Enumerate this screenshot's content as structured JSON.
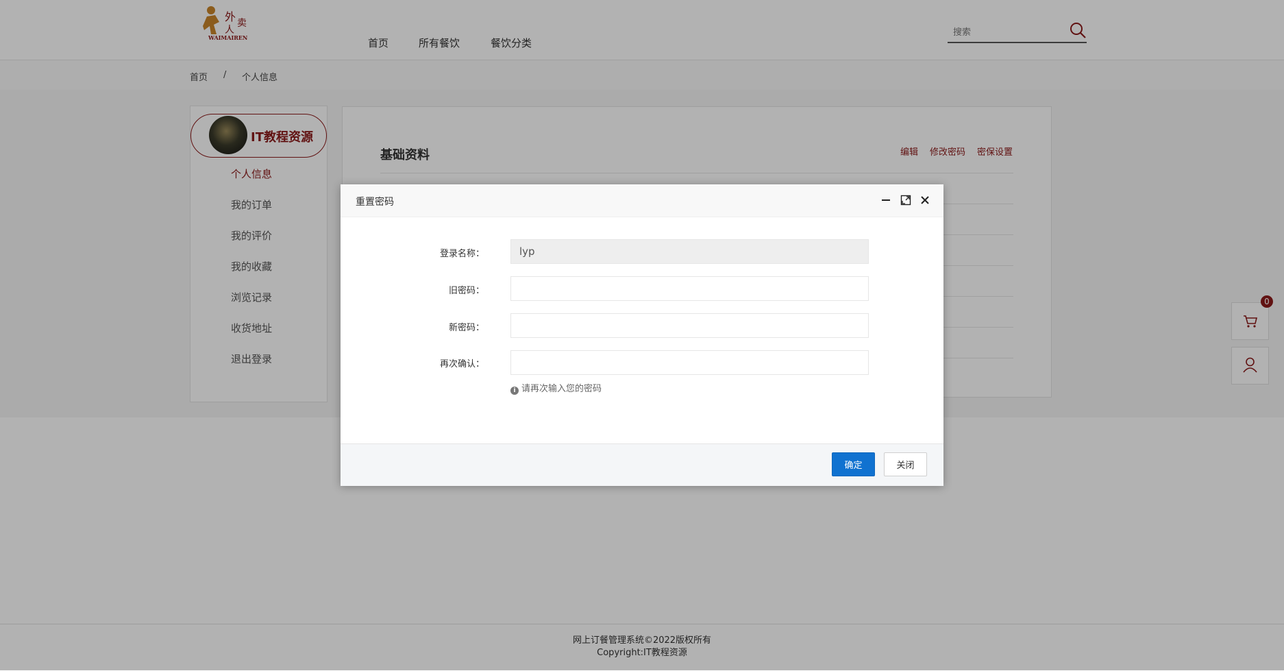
{
  "header": {
    "logo_alt": "WAIMAIREN",
    "nav": [
      "首页",
      "所有餐饮",
      "餐饮分类"
    ],
    "search_placeholder": "搜索"
  },
  "breadcrumb": {
    "home": "首页",
    "sep": "/",
    "current": "个人信息"
  },
  "sidebar": {
    "user_name": "IT教程资源",
    "items": [
      {
        "label": "个人信息",
        "active": true
      },
      {
        "label": "我的订单"
      },
      {
        "label": "我的评价"
      },
      {
        "label": "我的收藏"
      },
      {
        "label": "浏览记录"
      },
      {
        "label": "收货地址"
      },
      {
        "label": "退出登录"
      }
    ]
  },
  "main": {
    "title": "基础资料",
    "links": [
      "编辑",
      "修改密码",
      "密保设置"
    ]
  },
  "float": {
    "cart_count": "0"
  },
  "footer": {
    "line1": "网上订餐管理系统©2022版权所有",
    "line2": "Copyright:IT教程资源"
  },
  "dialog": {
    "title": "重置密码",
    "fields": {
      "login_label": "登录名称：",
      "login_value": "lyp",
      "old_label": "旧密码：",
      "new_label": "新密码：",
      "confirm_label": "再次确认："
    },
    "hint": "请再次输入您的密码",
    "ok_label": "确定",
    "close_label": "关闭"
  },
  "colors": {
    "brand": "#8b1a1a",
    "primary": "#1072d0"
  }
}
